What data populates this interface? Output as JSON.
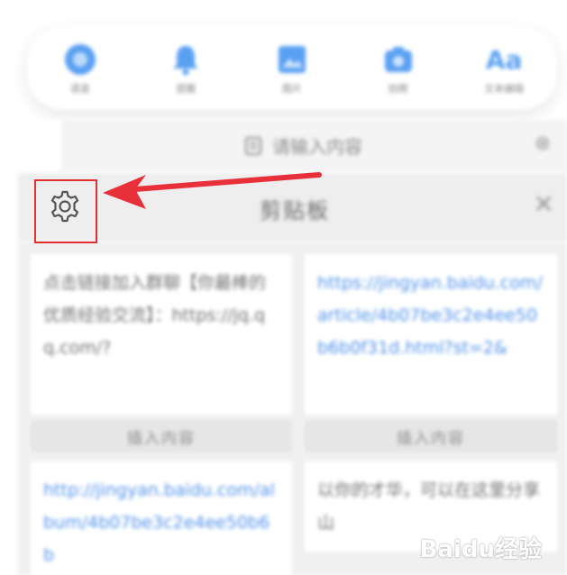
{
  "toolbar": {
    "items": [
      {
        "label": "语音",
        "icon": "mic-icon"
      },
      {
        "label": "提醒",
        "icon": "bell-icon"
      },
      {
        "label": "图片",
        "icon": "image-icon"
      },
      {
        "label": "拍照",
        "icon": "camera-icon"
      },
      {
        "label": "文本编辑",
        "icon": "text-format-icon",
        "glyph": "Aa"
      }
    ],
    "accent_color": "#5aa0f2"
  },
  "editor": {
    "placeholder": "请输入内容",
    "close_glyph": "⊗"
  },
  "clipboard": {
    "title": "剪贴板",
    "close_glyph": "✕",
    "cards": [
      {
        "type": "text",
        "text": "点击链接加入群聊【你最棒的优质经验交流】：https://jq.qq.com/?"
      },
      {
        "type": "link",
        "text": "https://jingyan.baidu.com/article/4b07be3c2e4ee50b6b0f31d.html?st=2&"
      },
      {
        "type": "link",
        "text": "http://jingyan.baidu.com/album/4b07be3c2e4ee50b6b"
      },
      {
        "type": "text",
        "text": "以你的才华，可以在这里分享山"
      }
    ],
    "insert_label": "插入内容"
  },
  "highlight_color": "#e23030",
  "watermark": "Baidu经验"
}
